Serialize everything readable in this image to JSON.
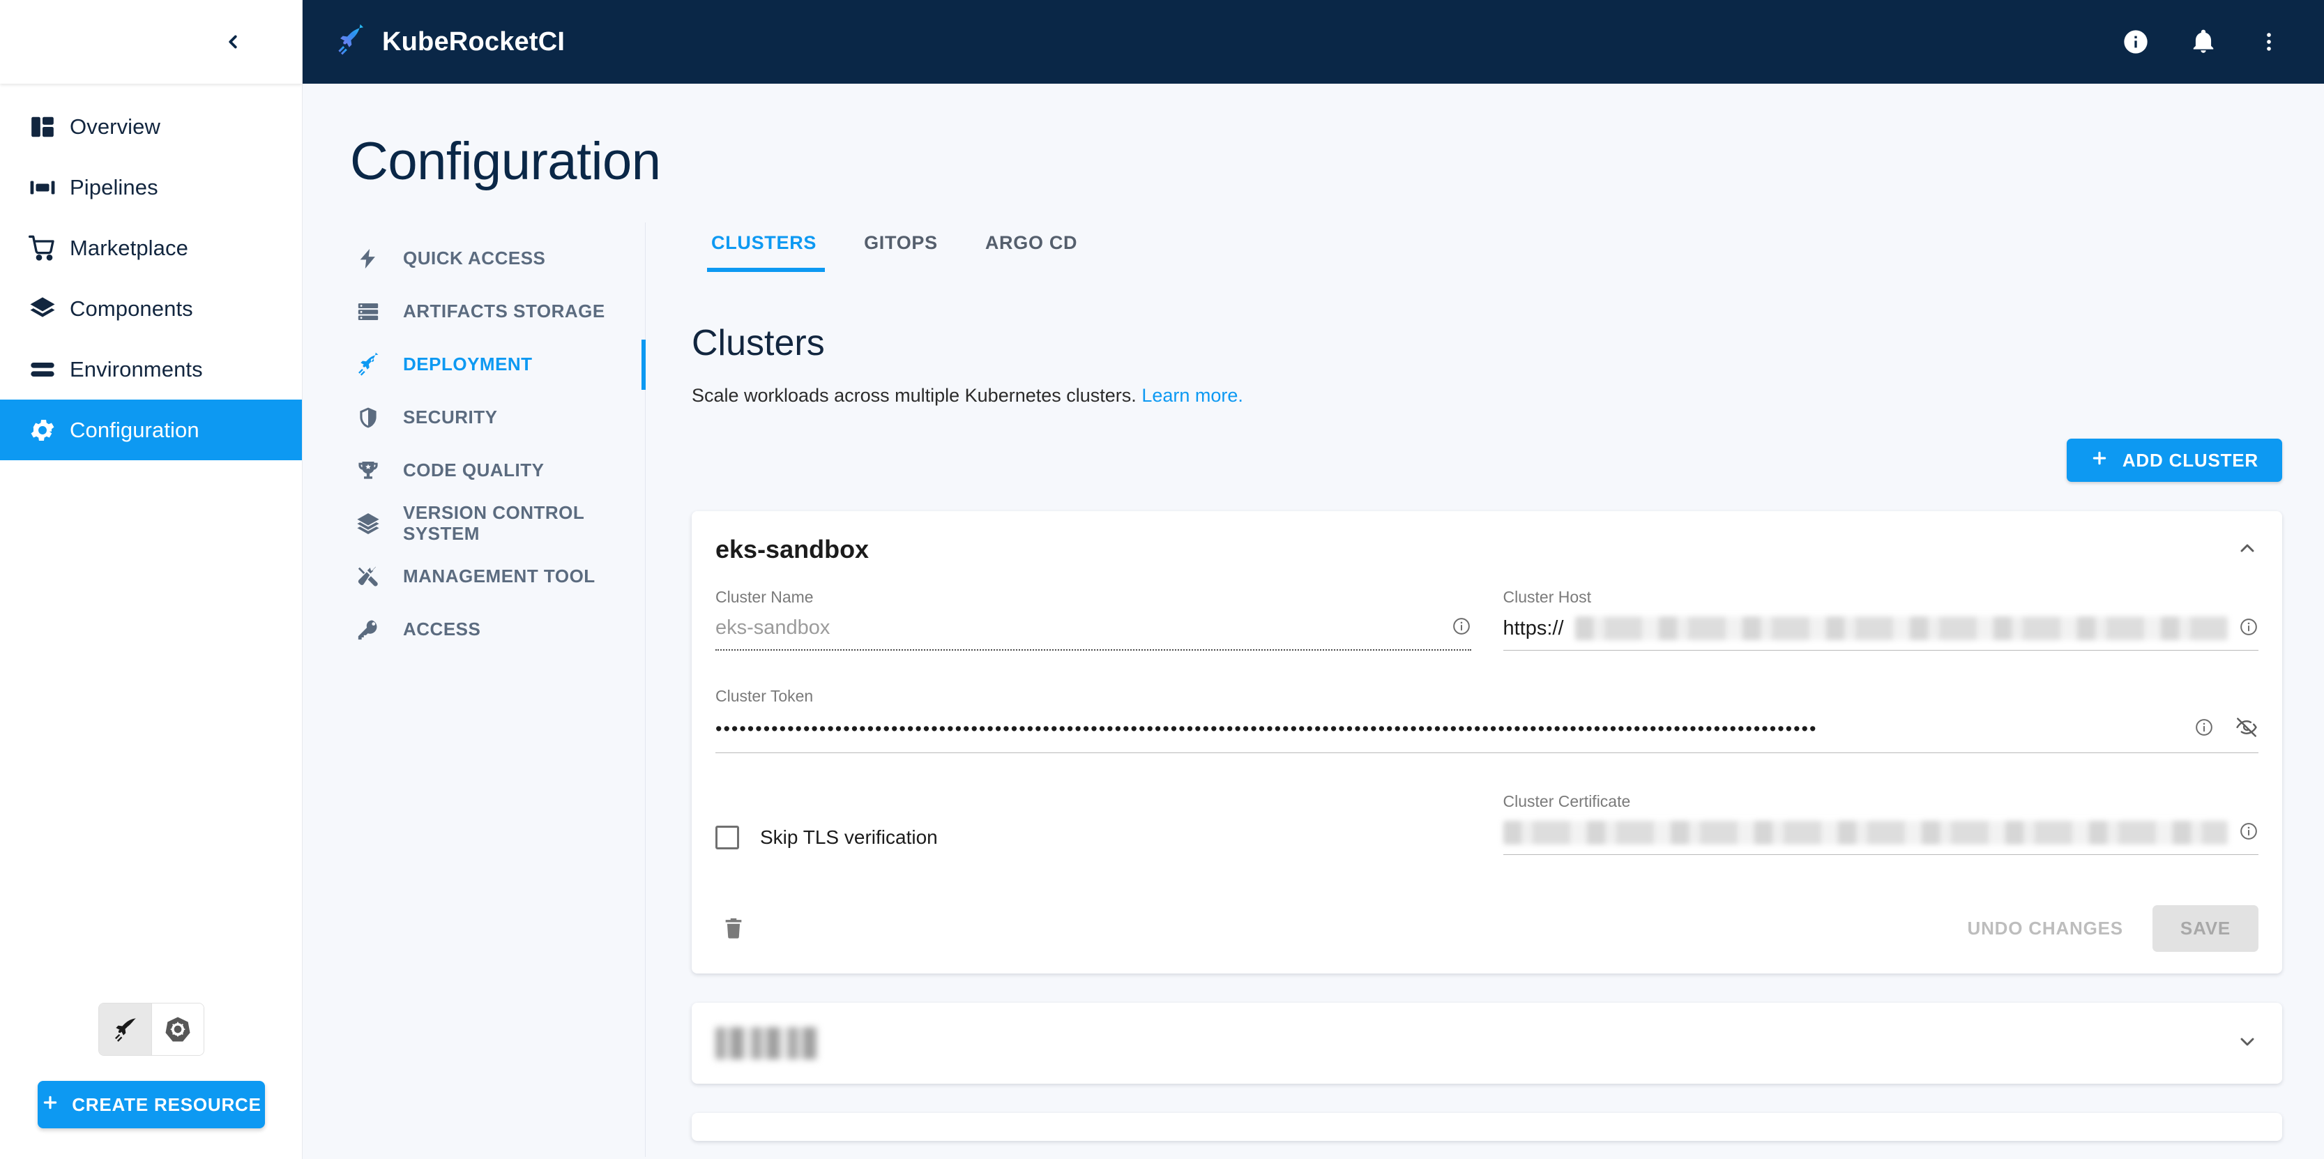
{
  "sidebar": {
    "collapse_icon": "chevron-left-icon",
    "items": [
      {
        "label": "Overview",
        "icon": "dashboard-icon",
        "active": false
      },
      {
        "label": "Pipelines",
        "icon": "pipelines-icon",
        "active": false
      },
      {
        "label": "Marketplace",
        "icon": "cart-icon",
        "active": false
      },
      {
        "label": "Components",
        "icon": "layers-icon",
        "active": false
      },
      {
        "label": "Environments",
        "icon": "environments-icon",
        "active": false
      },
      {
        "label": "Configuration",
        "icon": "gear-icon",
        "active": true
      }
    ],
    "mode_toggle": [
      {
        "icon": "kuberocket-rocket-icon",
        "selected": true
      },
      {
        "icon": "kubernetes-helm-icon",
        "selected": false
      }
    ],
    "create_resource_label": "CREATE RESOURCE",
    "create_resource_icon": "plus-icon"
  },
  "topbar": {
    "logo_icon": "kuberocket-logo-icon",
    "brand": "KubeRocketCI",
    "actions": [
      {
        "icon": "info-icon"
      },
      {
        "icon": "bell-icon"
      },
      {
        "icon": "kebab-menu-icon"
      }
    ],
    "background": "#0a2747"
  },
  "page": {
    "title": "Configuration"
  },
  "submenu": {
    "items": [
      {
        "label": "QUICK ACCESS",
        "icon": "bolt-icon",
        "active": false
      },
      {
        "label": "ARTIFACTS STORAGE",
        "icon": "storage-icon",
        "active": false
      },
      {
        "label": "DEPLOYMENT",
        "icon": "rocket-icon",
        "active": true
      },
      {
        "label": "SECURITY",
        "icon": "shield-icon",
        "active": false
      },
      {
        "label": "CODE QUALITY",
        "icon": "trophy-icon",
        "active": false
      },
      {
        "label": "VERSION CONTROL SYSTEM",
        "icon": "layers-icon",
        "active": false
      },
      {
        "label": "MANAGEMENT TOOL",
        "icon": "tools-icon",
        "active": false
      },
      {
        "label": "ACCESS",
        "icon": "key-icon",
        "active": false
      }
    ]
  },
  "tabs": [
    {
      "label": "CLUSTERS",
      "active": true
    },
    {
      "label": "GITOPS",
      "active": false
    },
    {
      "label": "ARGO CD",
      "active": false
    }
  ],
  "section": {
    "heading": "Clusters",
    "description": "Scale workloads across multiple Kubernetes clusters.",
    "link_label": "Learn more.",
    "add_button_label": "ADD CLUSTER",
    "add_button_icon": "plus-icon"
  },
  "cluster_card": {
    "title": "eks-sandbox",
    "collapse_icon": "chevron-up-icon",
    "fields": {
      "cluster_name": {
        "label": "Cluster Name",
        "value": "eks-sandbox",
        "info_icon": "info-circle-icon"
      },
      "cluster_host": {
        "label": "Cluster Host",
        "prefix": "https://",
        "value": "",
        "redacted": true,
        "info_icon": "info-circle-icon"
      },
      "cluster_token": {
        "label": "Cluster Token",
        "masked_value": "••••••••••••••••••••••••••••••••••••••••••••••••••••••••••••••••••••••••••••••••••••••••••••••••••••••••••••••••••••••••••••••••••••••••••",
        "info_icon": "info-circle-icon",
        "visibility_icon": "eye-off-icon"
      },
      "skip_tls": {
        "label": "Skip TLS verification",
        "checked": false
      },
      "cluster_certificate": {
        "label": "Cluster Certificate",
        "value": "",
        "redacted": true,
        "info_icon": "info-circle-icon"
      }
    },
    "actions": {
      "delete_icon": "trash-icon",
      "undo_label": "UNDO CHANGES",
      "save_label": "SAVE"
    }
  },
  "cluster_card_collapsed": {
    "title": "",
    "redacted": true,
    "expand_icon": "chevron-down-icon"
  },
  "colors": {
    "accent": "#0d99f2",
    "navy": "#0a2747",
    "page_bg": "#f6f8fc",
    "card_bg": "#ffffff",
    "muted_text": "#5b6b7f"
  }
}
